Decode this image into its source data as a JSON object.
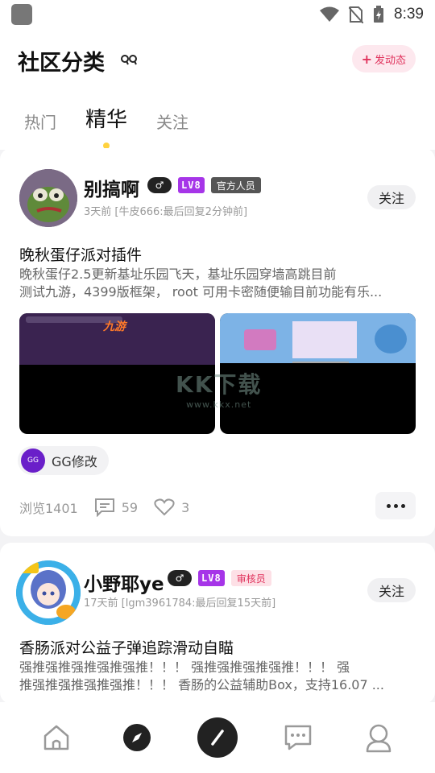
{
  "status_bar": {
    "time": "8:39"
  },
  "header": {
    "title": "社区分类",
    "post_button": "发动态",
    "tabs": [
      {
        "label": "热门",
        "active": false
      },
      {
        "label": "精华",
        "active": true
      },
      {
        "label": "关注",
        "active": false
      }
    ]
  },
  "posts": [
    {
      "username": "别搞啊",
      "gender": "♂",
      "level": "LV8",
      "role": "官方人员",
      "meta": "3天前 [牛皮666:最后回复2分钟前]",
      "follow_label": "关注",
      "title": "晚秋蛋仔派对插件",
      "body_line1": "晚秋蛋仔2.5更新基址乐园飞天，基址乐园穿墙高跳目前",
      "body_line2": "测试九游，4399版框架，  root 可用卡密随便输目前功能有乐...",
      "image_text": "九游",
      "watermark_main": "KK下载",
      "watermark_sub": "www.kkx.net",
      "tag": "GG修改",
      "tag_icon_text": "GG",
      "views": "浏览1401",
      "comments": "59",
      "likes": "3"
    },
    {
      "username": "小野耶ye",
      "gender": "♂",
      "level": "LV8",
      "role": "审核员",
      "meta": "17天前 [lgm3961784:最后回复15天前]",
      "follow_label": "关注",
      "title": "香肠派对公益子弹追踪滑动自瞄",
      "body_line1": "强推强推强推强推强推！！！ 强推强推强推强推！！！ 强",
      "body_line2": "推强推强推强推强推！！！ 香肠的公益辅助Box，支持16.07 ..."
    }
  ],
  "colors": {
    "accent_pink": "#e0325c",
    "level_purple": "#a635e8",
    "tab_dot": "#ffd23f"
  }
}
